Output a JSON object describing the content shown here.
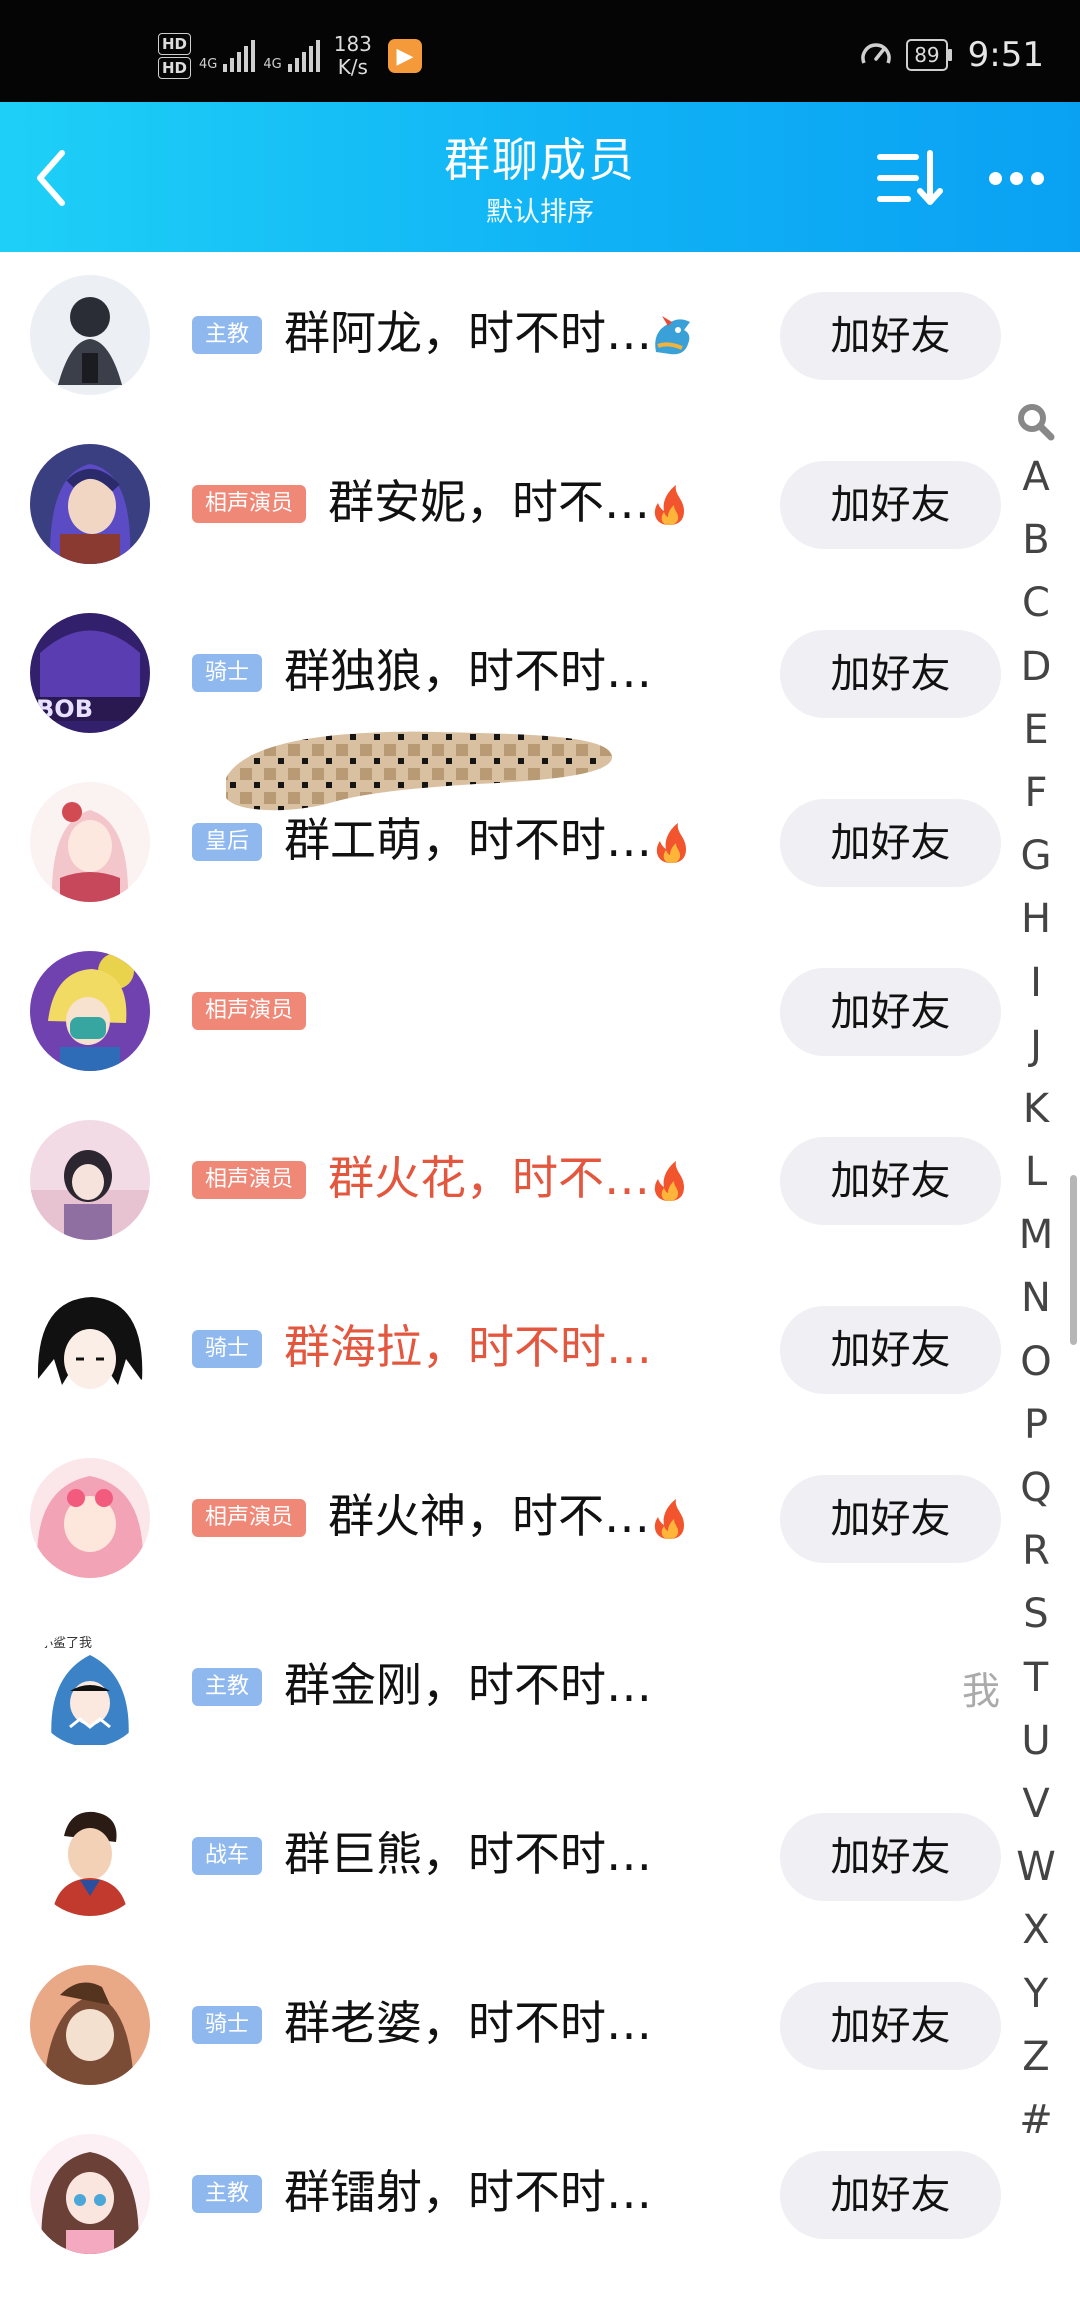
{
  "status_bar": {
    "hd1": "HD",
    "hd2": "HD",
    "net1": "4G",
    "net2": "4G",
    "speed_value": "183",
    "speed_unit": "K/s",
    "battery": "89",
    "time": "9:51"
  },
  "header": {
    "title": "群聊成员",
    "subtitle": "默认排序",
    "icons": [
      "back-icon",
      "sort-icon",
      "more-icon"
    ]
  },
  "members": [
    {
      "badge": "主教",
      "badge_color": "#8fb8ee",
      "name": "群阿龙，时不时…",
      "name_color": "#111111",
      "emoji": "dragon",
      "button": "加好友"
    },
    {
      "badge": "相声演员",
      "badge_color": "#f08878",
      "name": "群安妮，时不…",
      "name_color": "#111111",
      "emoji": "fire",
      "button": "加好友"
    },
    {
      "badge": "骑士",
      "badge_color": "#8fb8ee",
      "name": "群独狼，时不时…",
      "name_color": "#111111",
      "emoji": "",
      "button": "加好友"
    },
    {
      "badge": "皇后",
      "badge_color": "#8fb8ee",
      "name": "群工萌，时不时…",
      "name_color": "#111111",
      "emoji": "fire",
      "button": "加好友"
    },
    {
      "badge": "相声演员",
      "badge_color": "#f08878",
      "name": "",
      "name_color": "#111111",
      "emoji": "",
      "button": "加好友",
      "redacted": true
    },
    {
      "badge": "相声演员",
      "badge_color": "#f08878",
      "name": "群火花，时不…",
      "name_color": "#e3573f",
      "emoji": "fire",
      "button": "加好友"
    },
    {
      "badge": "骑士",
      "badge_color": "#8fb8ee",
      "name": "群海拉，时不时…",
      "name_color": "#e3573f",
      "emoji": "",
      "button": "加好友"
    },
    {
      "badge": "相声演员",
      "badge_color": "#f08878",
      "name": "群火神，时不…",
      "name_color": "#111111",
      "emoji": "fire",
      "button": "加好友"
    },
    {
      "badge": "主教",
      "badge_color": "#8fb8ee",
      "name": "群金刚，时不时…",
      "name_color": "#111111",
      "emoji": "",
      "button": "",
      "self_label": "我"
    },
    {
      "badge": "战车",
      "badge_color": "#8fb8ee",
      "name": "群巨熊，时不时…",
      "name_color": "#111111",
      "emoji": "",
      "button": "加好友"
    },
    {
      "badge": "骑士",
      "badge_color": "#8fb8ee",
      "name": "群老婆，时不时…",
      "name_color": "#111111",
      "emoji": "",
      "button": "加好友"
    },
    {
      "badge": "主教",
      "badge_color": "#8fb8ee",
      "name": "群镭射，时不时…",
      "name_color": "#111111",
      "emoji": "",
      "button": "加好友"
    }
  ],
  "index_bar": {
    "search_icon": "search-icon",
    "letters": [
      "A",
      "B",
      "C",
      "D",
      "E",
      "F",
      "G",
      "H",
      "I",
      "J",
      "K",
      "L",
      "M",
      "N",
      "O",
      "P",
      "Q",
      "R",
      "S",
      "T",
      "U",
      "V",
      "W",
      "X",
      "Y",
      "Z",
      "#"
    ]
  }
}
